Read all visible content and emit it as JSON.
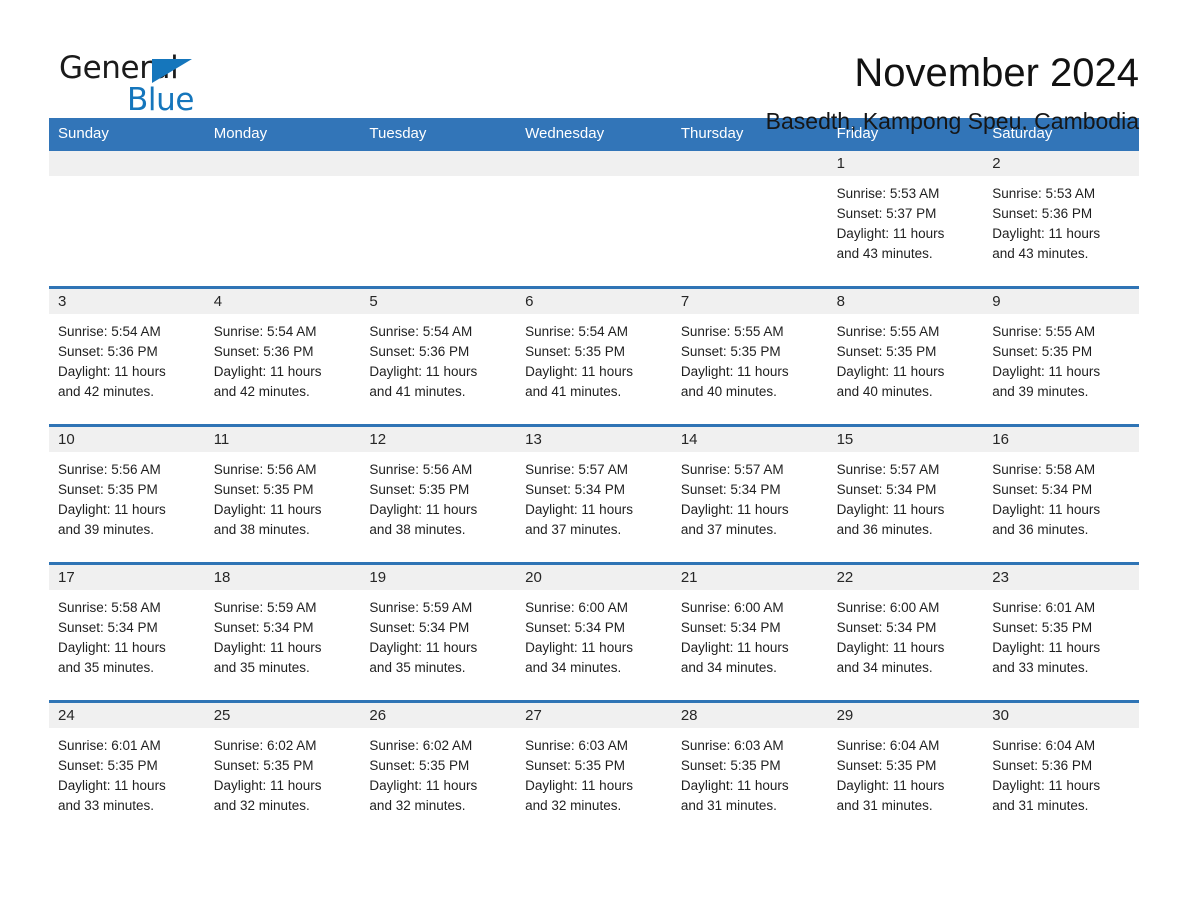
{
  "brand": {
    "name_part1": "General",
    "name_part2": "Blue",
    "accent_color": "#1576bc"
  },
  "header": {
    "title": "November 2024",
    "subtitle": "Basedth, Kampong Speu, Cambodia"
  },
  "calendar": {
    "header_color": "#3275b8",
    "weekdays": [
      "Sunday",
      "Monday",
      "Tuesday",
      "Wednesday",
      "Thursday",
      "Friday",
      "Saturday"
    ],
    "weeks": [
      [
        {
          "empty": true
        },
        {
          "empty": true
        },
        {
          "empty": true
        },
        {
          "empty": true
        },
        {
          "empty": true
        },
        {
          "day": "1",
          "sunrise": "Sunrise: 5:53 AM",
          "sunset": "Sunset: 5:37 PM",
          "daylight1": "Daylight: 11 hours",
          "daylight2": "and 43 minutes."
        },
        {
          "day": "2",
          "sunrise": "Sunrise: 5:53 AM",
          "sunset": "Sunset: 5:36 PM",
          "daylight1": "Daylight: 11 hours",
          "daylight2": "and 43 minutes."
        }
      ],
      [
        {
          "day": "3",
          "sunrise": "Sunrise: 5:54 AM",
          "sunset": "Sunset: 5:36 PM",
          "daylight1": "Daylight: 11 hours",
          "daylight2": "and 42 minutes."
        },
        {
          "day": "4",
          "sunrise": "Sunrise: 5:54 AM",
          "sunset": "Sunset: 5:36 PM",
          "daylight1": "Daylight: 11 hours",
          "daylight2": "and 42 minutes."
        },
        {
          "day": "5",
          "sunrise": "Sunrise: 5:54 AM",
          "sunset": "Sunset: 5:36 PM",
          "daylight1": "Daylight: 11 hours",
          "daylight2": "and 41 minutes."
        },
        {
          "day": "6",
          "sunrise": "Sunrise: 5:54 AM",
          "sunset": "Sunset: 5:35 PM",
          "daylight1": "Daylight: 11 hours",
          "daylight2": "and 41 minutes."
        },
        {
          "day": "7",
          "sunrise": "Sunrise: 5:55 AM",
          "sunset": "Sunset: 5:35 PM",
          "daylight1": "Daylight: 11 hours",
          "daylight2": "and 40 minutes."
        },
        {
          "day": "8",
          "sunrise": "Sunrise: 5:55 AM",
          "sunset": "Sunset: 5:35 PM",
          "daylight1": "Daylight: 11 hours",
          "daylight2": "and 40 minutes."
        },
        {
          "day": "9",
          "sunrise": "Sunrise: 5:55 AM",
          "sunset": "Sunset: 5:35 PM",
          "daylight1": "Daylight: 11 hours",
          "daylight2": "and 39 minutes."
        }
      ],
      [
        {
          "day": "10",
          "sunrise": "Sunrise: 5:56 AM",
          "sunset": "Sunset: 5:35 PM",
          "daylight1": "Daylight: 11 hours",
          "daylight2": "and 39 minutes."
        },
        {
          "day": "11",
          "sunrise": "Sunrise: 5:56 AM",
          "sunset": "Sunset: 5:35 PM",
          "daylight1": "Daylight: 11 hours",
          "daylight2": "and 38 minutes."
        },
        {
          "day": "12",
          "sunrise": "Sunrise: 5:56 AM",
          "sunset": "Sunset: 5:35 PM",
          "daylight1": "Daylight: 11 hours",
          "daylight2": "and 38 minutes."
        },
        {
          "day": "13",
          "sunrise": "Sunrise: 5:57 AM",
          "sunset": "Sunset: 5:34 PM",
          "daylight1": "Daylight: 11 hours",
          "daylight2": "and 37 minutes."
        },
        {
          "day": "14",
          "sunrise": "Sunrise: 5:57 AM",
          "sunset": "Sunset: 5:34 PM",
          "daylight1": "Daylight: 11 hours",
          "daylight2": "and 37 minutes."
        },
        {
          "day": "15",
          "sunrise": "Sunrise: 5:57 AM",
          "sunset": "Sunset: 5:34 PM",
          "daylight1": "Daylight: 11 hours",
          "daylight2": "and 36 minutes."
        },
        {
          "day": "16",
          "sunrise": "Sunrise: 5:58 AM",
          "sunset": "Sunset: 5:34 PM",
          "daylight1": "Daylight: 11 hours",
          "daylight2": "and 36 minutes."
        }
      ],
      [
        {
          "day": "17",
          "sunrise": "Sunrise: 5:58 AM",
          "sunset": "Sunset: 5:34 PM",
          "daylight1": "Daylight: 11 hours",
          "daylight2": "and 35 minutes."
        },
        {
          "day": "18",
          "sunrise": "Sunrise: 5:59 AM",
          "sunset": "Sunset: 5:34 PM",
          "daylight1": "Daylight: 11 hours",
          "daylight2": "and 35 minutes."
        },
        {
          "day": "19",
          "sunrise": "Sunrise: 5:59 AM",
          "sunset": "Sunset: 5:34 PM",
          "daylight1": "Daylight: 11 hours",
          "daylight2": "and 35 minutes."
        },
        {
          "day": "20",
          "sunrise": "Sunrise: 6:00 AM",
          "sunset": "Sunset: 5:34 PM",
          "daylight1": "Daylight: 11 hours",
          "daylight2": "and 34 minutes."
        },
        {
          "day": "21",
          "sunrise": "Sunrise: 6:00 AM",
          "sunset": "Sunset: 5:34 PM",
          "daylight1": "Daylight: 11 hours",
          "daylight2": "and 34 minutes."
        },
        {
          "day": "22",
          "sunrise": "Sunrise: 6:00 AM",
          "sunset": "Sunset: 5:34 PM",
          "daylight1": "Daylight: 11 hours",
          "daylight2": "and 34 minutes."
        },
        {
          "day": "23",
          "sunrise": "Sunrise: 6:01 AM",
          "sunset": "Sunset: 5:35 PM",
          "daylight1": "Daylight: 11 hours",
          "daylight2": "and 33 minutes."
        }
      ],
      [
        {
          "day": "24",
          "sunrise": "Sunrise: 6:01 AM",
          "sunset": "Sunset: 5:35 PM",
          "daylight1": "Daylight: 11 hours",
          "daylight2": "and 33 minutes."
        },
        {
          "day": "25",
          "sunrise": "Sunrise: 6:02 AM",
          "sunset": "Sunset: 5:35 PM",
          "daylight1": "Daylight: 11 hours",
          "daylight2": "and 32 minutes."
        },
        {
          "day": "26",
          "sunrise": "Sunrise: 6:02 AM",
          "sunset": "Sunset: 5:35 PM",
          "daylight1": "Daylight: 11 hours",
          "daylight2": "and 32 minutes."
        },
        {
          "day": "27",
          "sunrise": "Sunrise: 6:03 AM",
          "sunset": "Sunset: 5:35 PM",
          "daylight1": "Daylight: 11 hours",
          "daylight2": "and 32 minutes."
        },
        {
          "day": "28",
          "sunrise": "Sunrise: 6:03 AM",
          "sunset": "Sunset: 5:35 PM",
          "daylight1": "Daylight: 11 hours",
          "daylight2": "and 31 minutes."
        },
        {
          "day": "29",
          "sunrise": "Sunrise: 6:04 AM",
          "sunset": "Sunset: 5:35 PM",
          "daylight1": "Daylight: 11 hours",
          "daylight2": "and 31 minutes."
        },
        {
          "day": "30",
          "sunrise": "Sunrise: 6:04 AM",
          "sunset": "Sunset: 5:36 PM",
          "daylight1": "Daylight: 11 hours",
          "daylight2": "and 31 minutes."
        }
      ]
    ]
  }
}
